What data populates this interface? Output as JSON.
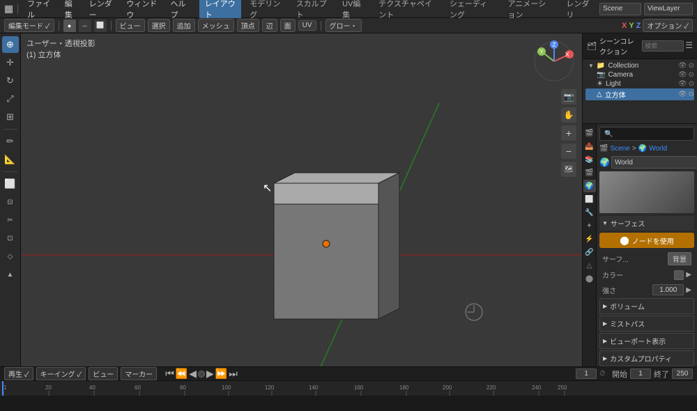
{
  "topbar": {
    "menus": [
      "ファイル",
      "編集",
      "レンダー",
      "ウィンドウ",
      "ヘルプ"
    ],
    "editor_type_label": "🔲",
    "scene_input": "Scene",
    "viewlayer_input": "ViewLayer"
  },
  "workspace_tabs": [
    {
      "label": "レイアウト",
      "active": true
    },
    {
      "label": "モデリング",
      "active": false
    },
    {
      "label": "スカルプト",
      "active": false
    },
    {
      "label": "UV編集",
      "active": false
    },
    {
      "label": "テクスチャペイント",
      "active": false
    },
    {
      "label": "シェーディング",
      "active": false
    },
    {
      "label": "アニメーション",
      "active": false
    },
    {
      "label": "レンダリ",
      "active": false
    }
  ],
  "viewport": {
    "info_line1": "ユーザー・透視投影",
    "info_line2": "(1) 立方体",
    "axes": [
      "X",
      "Y",
      "Z"
    ]
  },
  "toolbar": {
    "mode_label": "編集モード ✓",
    "view_label": "ビュー",
    "select_label": "選択",
    "add_label": "追加",
    "mesh_label": "メッシュ",
    "vertex_label": "頂点",
    "edge_label": "辺",
    "face_label": "面",
    "uv_label": "UV",
    "glow_label": "グロー・",
    "options_label": "オプション ✓",
    "coord_labels": [
      "X",
      "Y",
      "Z"
    ]
  },
  "scene_collection": {
    "title": "シーンコレクション",
    "items": [
      {
        "name": "Collection",
        "type": "collection",
        "indent": 0
      },
      {
        "name": "Camera",
        "type": "camera",
        "indent": 1
      },
      {
        "name": "Light",
        "type": "light",
        "indent": 1
      },
      {
        "name": "立方体",
        "type": "mesh",
        "indent": 1,
        "selected": true
      }
    ]
  },
  "world_props": {
    "breadcrumb": [
      "Scene",
      ">",
      "World"
    ],
    "world_name": "World",
    "surface_section": "サーフェス",
    "use_nodes_btn": "ノードを使用",
    "surf_label": "サーフ...",
    "background_label": "背景",
    "color_label": "カラー",
    "strength_label": "強さ",
    "strength_value": "1.000",
    "volume_section": "ボリューム",
    "mist_section": "ミストパス",
    "viewport_section": "ビューポート表示",
    "custom_section": "カスタムプロパティ"
  },
  "timeline": {
    "playback_btns": [
      "再生 ✓",
      "キーイング ✓",
      "ビュー",
      "マーカー"
    ],
    "frame_current": "1",
    "start_label": "開始",
    "start_value": "1",
    "end_label": "終了",
    "end_value": "250",
    "ruler_marks": [
      "1",
      "20",
      "40",
      "60",
      "80",
      "100",
      "120",
      "140",
      "160",
      "180",
      "200",
      "220",
      "240",
      "250"
    ]
  },
  "icons": {
    "arrow_right": "▶",
    "arrow_down": "▼",
    "arrow_left": "◀",
    "search": "🔍",
    "mesh": "△",
    "camera": "📷",
    "light": "☀",
    "collection": "📁",
    "cursor": "⊕",
    "move": "✛",
    "rotate": "↻",
    "scale": "⤢",
    "transform": "⊞",
    "annotate": "✏",
    "measure": "📐",
    "object": "⬜",
    "world": "🌍",
    "node_dot": "●"
  }
}
